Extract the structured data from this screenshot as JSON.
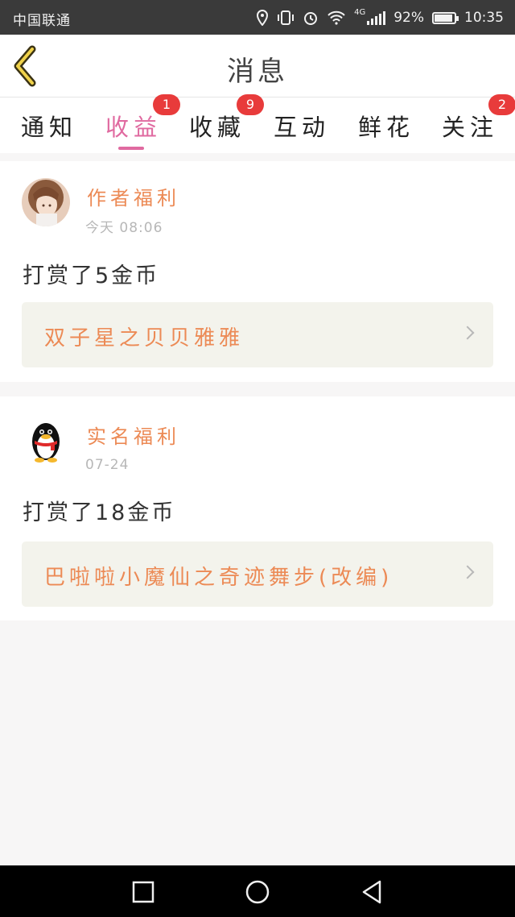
{
  "status_bar": {
    "carrier": "中国联通",
    "network": "4G",
    "battery": "92%",
    "battery_level": 0.92,
    "time": "10:35"
  },
  "header": {
    "title": "消息"
  },
  "tabs": [
    {
      "label": "通知",
      "badge": ""
    },
    {
      "label": "收益",
      "badge": "1",
      "active": true
    },
    {
      "label": "收藏",
      "badge": "9"
    },
    {
      "label": "互动",
      "badge": ""
    },
    {
      "label": "鲜花",
      "badge": ""
    },
    {
      "label": "关注",
      "badge": "2"
    }
  ],
  "messages": [
    {
      "sender": "作者福利",
      "time": "今天  08:06",
      "text": "打赏了5金币",
      "book": "双子星之贝贝雅雅"
    },
    {
      "sender": "实名福利",
      "time": "07-24",
      "text": "打赏了18金币",
      "book": "巴啦啦小魔仙之奇迹舞步(改编)"
    }
  ],
  "colors": {
    "accent_pink": "#e06aa0",
    "accent_orange": "#ec8a55",
    "badge_red": "#e83b3b"
  }
}
